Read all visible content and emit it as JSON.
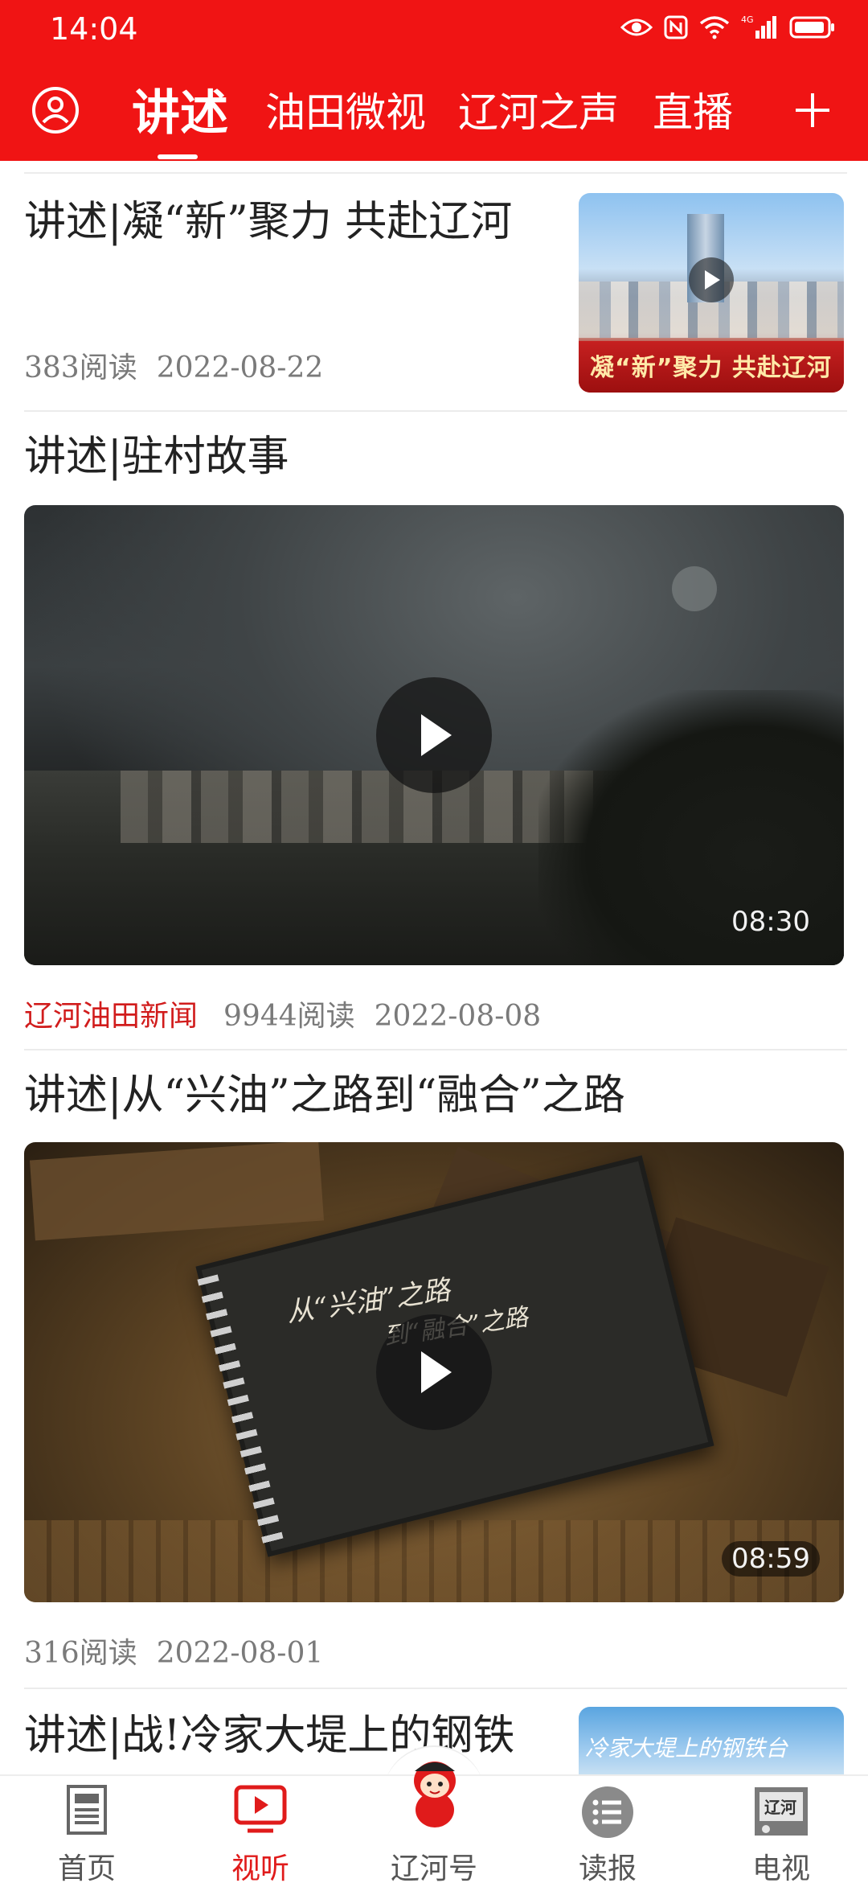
{
  "status": {
    "time": "14:04",
    "network": "4G"
  },
  "nav": {
    "tabs": [
      {
        "label": "讲述",
        "active": true
      },
      {
        "label": "油田微视",
        "active": false
      },
      {
        "label": "辽河之声",
        "active": false
      },
      {
        "label": "直播",
        "active": false
      }
    ],
    "user_icon": "user-icon",
    "add_icon": "plus-icon"
  },
  "feed": [
    {
      "title": "讲述|凝“新”聚力 共赴辽河",
      "reads": "383阅读",
      "date": "2022-08-22",
      "thumb_caption": "凝“新”聚力 共赴辽河"
    },
    {
      "title": "讲述|驻村故事",
      "duration": "08:30",
      "source": "辽河油田新闻",
      "reads": "9944阅读",
      "date": "2022-08-08"
    },
    {
      "title": "讲述|从“兴油”之路到“融合”之路",
      "duration": "08:59",
      "reads": "316阅读",
      "date": "2022-08-01",
      "video_text_1": "从“兴油”之路",
      "video_text_2": "到“融合”之路"
    },
    {
      "title": "讲述|战!冷家大堤上的钢铁",
      "thumb_caption": "冷家大堤上的钢铁台"
    }
  ],
  "bottom_nav": [
    {
      "label": "首页",
      "icon": "newspaper-icon",
      "active": false
    },
    {
      "label": "视听",
      "icon": "play-video-icon",
      "active": true
    },
    {
      "label": "辽河号",
      "icon": "mascot-icon",
      "active": false
    },
    {
      "label": "读报",
      "icon": "list-icon",
      "active": false
    },
    {
      "label": "电视",
      "icon": "tv-icon",
      "active": false
    }
  ],
  "colors": {
    "brand_red": "#f01414",
    "active_red": "#e01b1b",
    "source_red": "#d11c1c"
  }
}
